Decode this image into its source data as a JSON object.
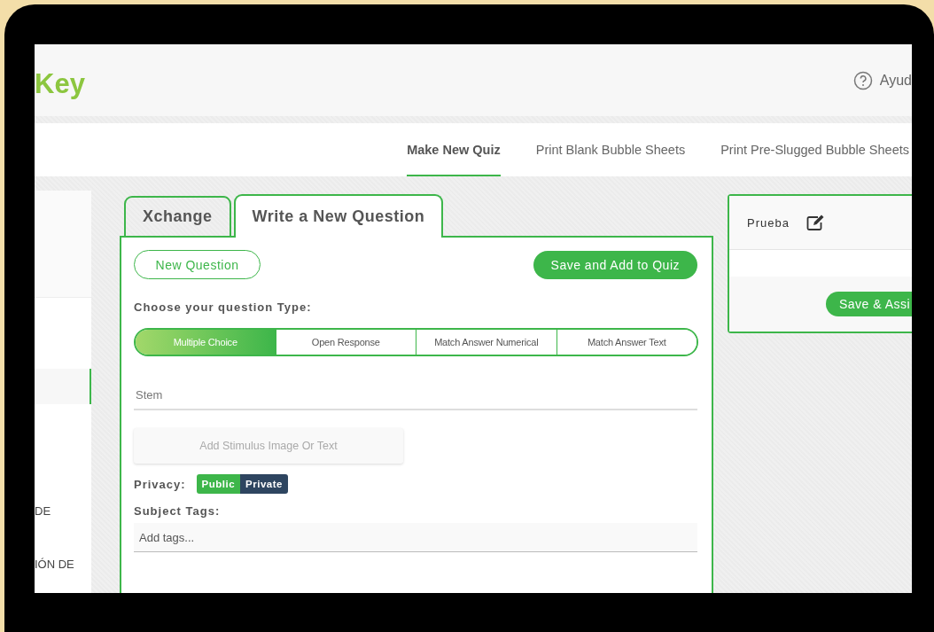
{
  "brand": {
    "logo_text": "Key"
  },
  "header": {
    "help_label": "Ayud"
  },
  "nav": [
    {
      "label": "Make New Quiz",
      "selected": true
    },
    {
      "label": "Print Blank Bubble Sheets",
      "selected": false
    },
    {
      "label": "Print Pre-Slugged Bubble Sheets",
      "selected": false
    }
  ],
  "sidebar": {
    "items": [
      {
        "selected": true
      },
      {
        "label": "DE",
        "selected": false
      },
      {
        "label": "IÓN DE",
        "selected": false
      }
    ]
  },
  "editor": {
    "tabs": [
      {
        "label": "Xchange",
        "selected": false
      },
      {
        "label": "Write a New Question",
        "selected": true
      }
    ],
    "new_question_button": "New Question",
    "save_button": "Save and Add to Quiz",
    "type_label": "Choose your question Type:",
    "question_types": [
      {
        "label": "Multiple Choice",
        "selected": true
      },
      {
        "label": "Open Response",
        "selected": false
      },
      {
        "label": "Match Answer Numerical",
        "selected": false
      },
      {
        "label": "Match Answer Text",
        "selected": false
      }
    ],
    "stem": {
      "placeholder": "Stem"
    },
    "stimulus_button": "Add Stimulus Image Or Text",
    "privacy": {
      "label": "Privacy:",
      "options": [
        {
          "label": "Public",
          "selected": true
        },
        {
          "label": "Private",
          "selected": false
        }
      ]
    },
    "subject_tags": {
      "label": "Subject Tags:",
      "placeholder": "Add tags..."
    }
  },
  "quiz_panel": {
    "title": "Prueba",
    "button": "Save & Assi"
  }
}
